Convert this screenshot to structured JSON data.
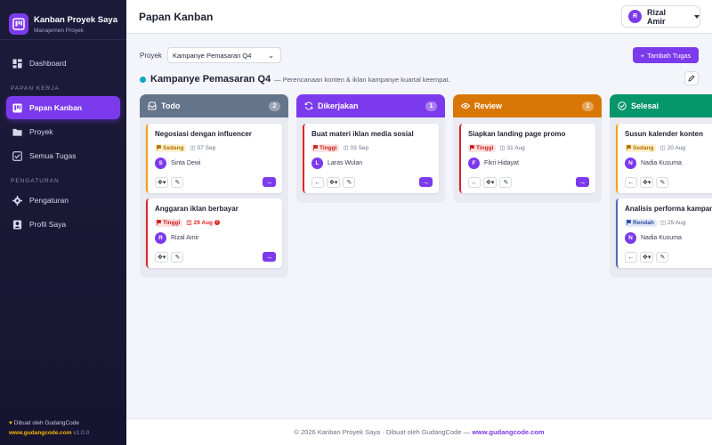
{
  "brand": {
    "title": "Kanban Proyek Saya",
    "subtitle": "Manajemen Proyek"
  },
  "sidebar": {
    "items": [
      {
        "label": "Dashboard",
        "icon": "dashboard-icon"
      },
      {
        "label": "Papan Kanban",
        "icon": "kanban-icon",
        "active": true
      },
      {
        "label": "Proyek",
        "icon": "folder-icon"
      },
      {
        "label": "Semua Tugas",
        "icon": "checklist-icon"
      },
      {
        "label": "Pengaturan",
        "icon": "gear-icon"
      },
      {
        "label": "Profil Saya",
        "icon": "profile-icon"
      }
    ],
    "section_work": "PAPAN KERJA",
    "section_settings": "PENGATURAN",
    "footer_line1": "Dibuat oleh GudangCode",
    "footer_url": "www.gudangcode.com",
    "footer_version": "v1.0.0"
  },
  "header": {
    "title": "Papan Kanban",
    "user_initial": "R",
    "user_name": "Rizal Amir"
  },
  "toolbar": {
    "project_label": "Proyek",
    "project_value": "Kampanye Pemasaran Q4",
    "add_label": "Tambah Tugas"
  },
  "project": {
    "name": "Kampanye Pemasaran Q4",
    "description": "— Perencanaan konten & iklan kampanye kuartal keempat.",
    "accent": "#0ea5c6"
  },
  "columns": [
    {
      "title": "Todo",
      "count": "2",
      "color": "#64748b",
      "cards": [
        {
          "title": "Negosiasi dengan influencer",
          "priority": "Sedang",
          "date": "07 Sep",
          "initial": "S",
          "assignee": "Sinta Dewi"
        },
        {
          "title": "Anggaran iklan berbayar",
          "priority": "Tinggi",
          "date": "29 Aug",
          "initial": "R",
          "assignee": "Rizal Amir"
        }
      ]
    },
    {
      "title": "Dikerjakan",
      "count": "1",
      "color": "#7c3aed",
      "cards": [
        {
          "title": "Buat materi iklan media sosial",
          "priority": "Tinggi",
          "date": "03 Sep",
          "initial": "L",
          "assignee": "Laras Wulan"
        }
      ]
    },
    {
      "title": "Review",
      "count": "1",
      "color": "#d97706",
      "cards": [
        {
          "title": "Siapkan landing page promo",
          "priority": "Tinggi",
          "date": "31 Aug",
          "initial": "F",
          "assignee": "Fikri Hidayat"
        }
      ]
    },
    {
      "title": "Selesai",
      "count": "",
      "color": "#059669",
      "cards": [
        {
          "title": "Susun kalender konten",
          "priority": "Sedang",
          "date": "20 Aug",
          "initial": "N",
          "assignee": "Nadia Kusuma"
        },
        {
          "title": "Analisis performa kampanye",
          "priority": "Rendah",
          "date": "25 Aug",
          "initial": "N",
          "assignee": "Nadia Kusuma"
        }
      ]
    }
  ],
  "footer": {
    "text": "© 2026 Kanban Proyek Saya · Dibuat oleh GudangCode — ",
    "link": "www.gudangcode.com"
  },
  "colors": {
    "accent": "#7c3aed",
    "sidebar_bg": "#1d1b3a",
    "priority_high": "#c81e1e",
    "priority_mid": "#b27100",
    "priority_low": "#284d9b"
  }
}
